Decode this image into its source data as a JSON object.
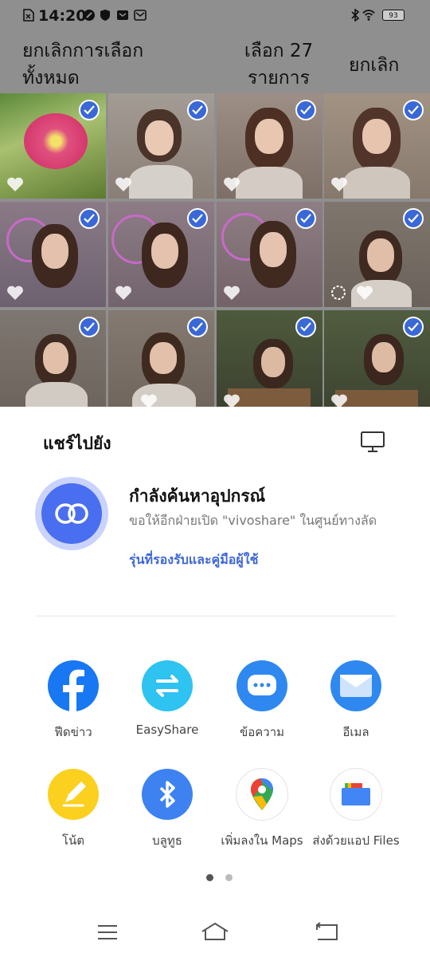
{
  "status_bar": {
    "time": "14:20",
    "battery": "93"
  },
  "header": {
    "deselect_all": "ยกเลิกการเลือกทั้งหมด",
    "selected_count": "เลือก 27 รายการ",
    "cancel": "ยกเลิก"
  },
  "share_sheet": {
    "title": "แชร์ไปยัง",
    "finding_title": "กำลังค้นหาอุปกรณ์",
    "finding_desc": "ขอให้อีกฝ่ายเปิด \"vivoshare\" ในศูนย์ทางลัด",
    "support_link": "รุ่นที่รองรับและคู่มือผู้ใช้"
  },
  "apps": [
    {
      "label": "ฟีดข่าว",
      "icon": "facebook-icon",
      "color": "#1877f2"
    },
    {
      "label": "EasyShare",
      "icon": "easyshare-icon",
      "color": "#2ec3f0"
    },
    {
      "label": "ข้อความ",
      "icon": "messages-icon",
      "color": "#2f88f0"
    },
    {
      "label": "อีเมล",
      "icon": "email-icon",
      "color": "#2f88f0"
    },
    {
      "label": "โน้ต",
      "icon": "notes-icon",
      "color": "#fbd01f"
    },
    {
      "label": "บลูทูธ",
      "icon": "bluetooth-icon",
      "color": "#3d82f0"
    },
    {
      "label": "เพิ่มลงใน Maps",
      "icon": "maps-icon",
      "color": "#ffffff"
    },
    {
      "label": "ส่งด้วยแอป Files",
      "icon": "files-icon",
      "color": "#ffffff"
    }
  ],
  "colors": {
    "accent": "#3a68d6",
    "overlay": "#8f8f8f"
  }
}
